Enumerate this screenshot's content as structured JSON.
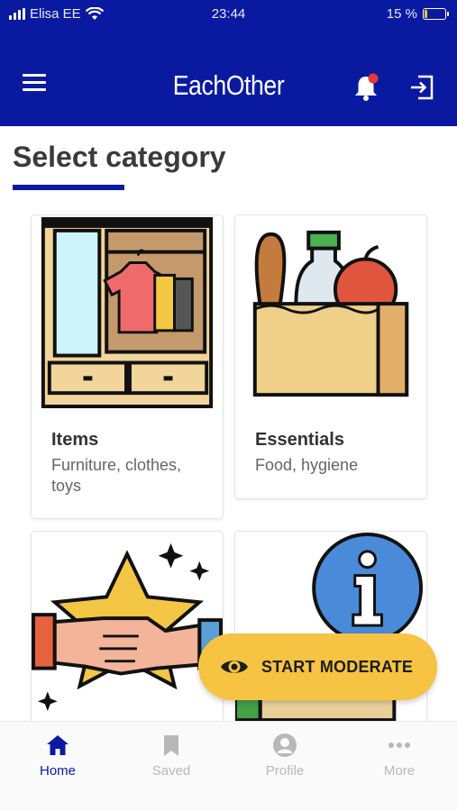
{
  "status_bar": {
    "carrier": "Elisa EE",
    "time": "23:44",
    "battery": "15 %",
    "battery_level": 0.15
  },
  "app_bar": {
    "title": "EachOther",
    "notification_dot_color": "#e53935"
  },
  "page": {
    "title": "Select category"
  },
  "categories": [
    {
      "title": "Items",
      "subtitle": "Furniture, clothes, toys",
      "icon": "wardrobe-illustration"
    },
    {
      "title": "Essentials",
      "subtitle": "Food, hygiene",
      "icon": "grocery-bag-illustration"
    },
    {
      "title": "",
      "subtitle": "",
      "icon": "handshake-star-illustration"
    },
    {
      "title": "",
      "subtitle": "",
      "icon": "info-illustration"
    }
  ],
  "fab": {
    "label": "START MODERATE",
    "icon": "eye-icon"
  },
  "bottom_nav": [
    {
      "label": "Home",
      "icon": "home-icon",
      "active": true
    },
    {
      "label": "Saved",
      "icon": "bookmark-icon",
      "active": false
    },
    {
      "label": "Profile",
      "icon": "profile-icon",
      "active": false
    },
    {
      "label": "More",
      "icon": "more-icon",
      "active": false
    }
  ],
  "colors": {
    "primary": "#0a1aa0",
    "accent": "#f6c342",
    "inactive": "#b8b8b8"
  }
}
